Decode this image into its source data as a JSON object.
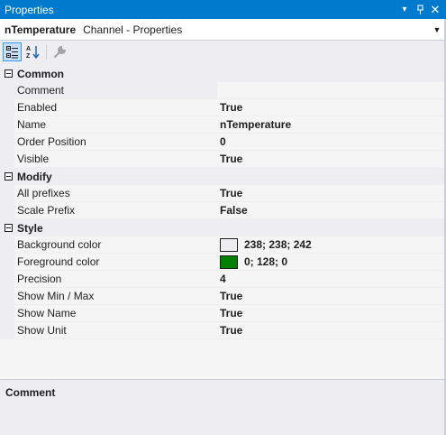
{
  "window": {
    "title": "Properties",
    "buttons": [
      "▾",
      "⊣",
      "✕"
    ]
  },
  "object_selector": {
    "name": "nTemperature",
    "type": "Channel - Properties"
  },
  "toolbar": {
    "categorized_icon": "categorized-icon",
    "alphabetical_icon": "alphabetical-icon",
    "property_pages_icon": "wrench-icon"
  },
  "categories": [
    {
      "label": "Common",
      "properties": [
        {
          "name": "Comment",
          "value": ""
        },
        {
          "name": "Enabled",
          "value": "True"
        },
        {
          "name": "Name",
          "value": "nTemperature"
        },
        {
          "name": "Order Position",
          "value": "0"
        },
        {
          "name": "Visible",
          "value": "True"
        }
      ]
    },
    {
      "label": "Modify",
      "properties": [
        {
          "name": "All prefixes",
          "value": "True"
        },
        {
          "name": "Scale Prefix",
          "value": "False"
        }
      ]
    },
    {
      "label": "Style",
      "properties": [
        {
          "name": "Background color",
          "value": "238; 238; 242",
          "swatch": "#eeeef2"
        },
        {
          "name": "Foreground color",
          "value": "0; 128; 0",
          "swatch": "#008000"
        },
        {
          "name": "Precision",
          "value": "4"
        },
        {
          "name": "Show Min / Max",
          "value": "True"
        },
        {
          "name": "Show Name",
          "value": "True"
        },
        {
          "name": "Show Unit",
          "value": "True"
        }
      ]
    }
  ],
  "description": {
    "title": "Comment",
    "text": ""
  },
  "colors": {
    "title_bar": "#007acc",
    "panel": "#eeeef2",
    "grid": "#f5f5f5"
  }
}
